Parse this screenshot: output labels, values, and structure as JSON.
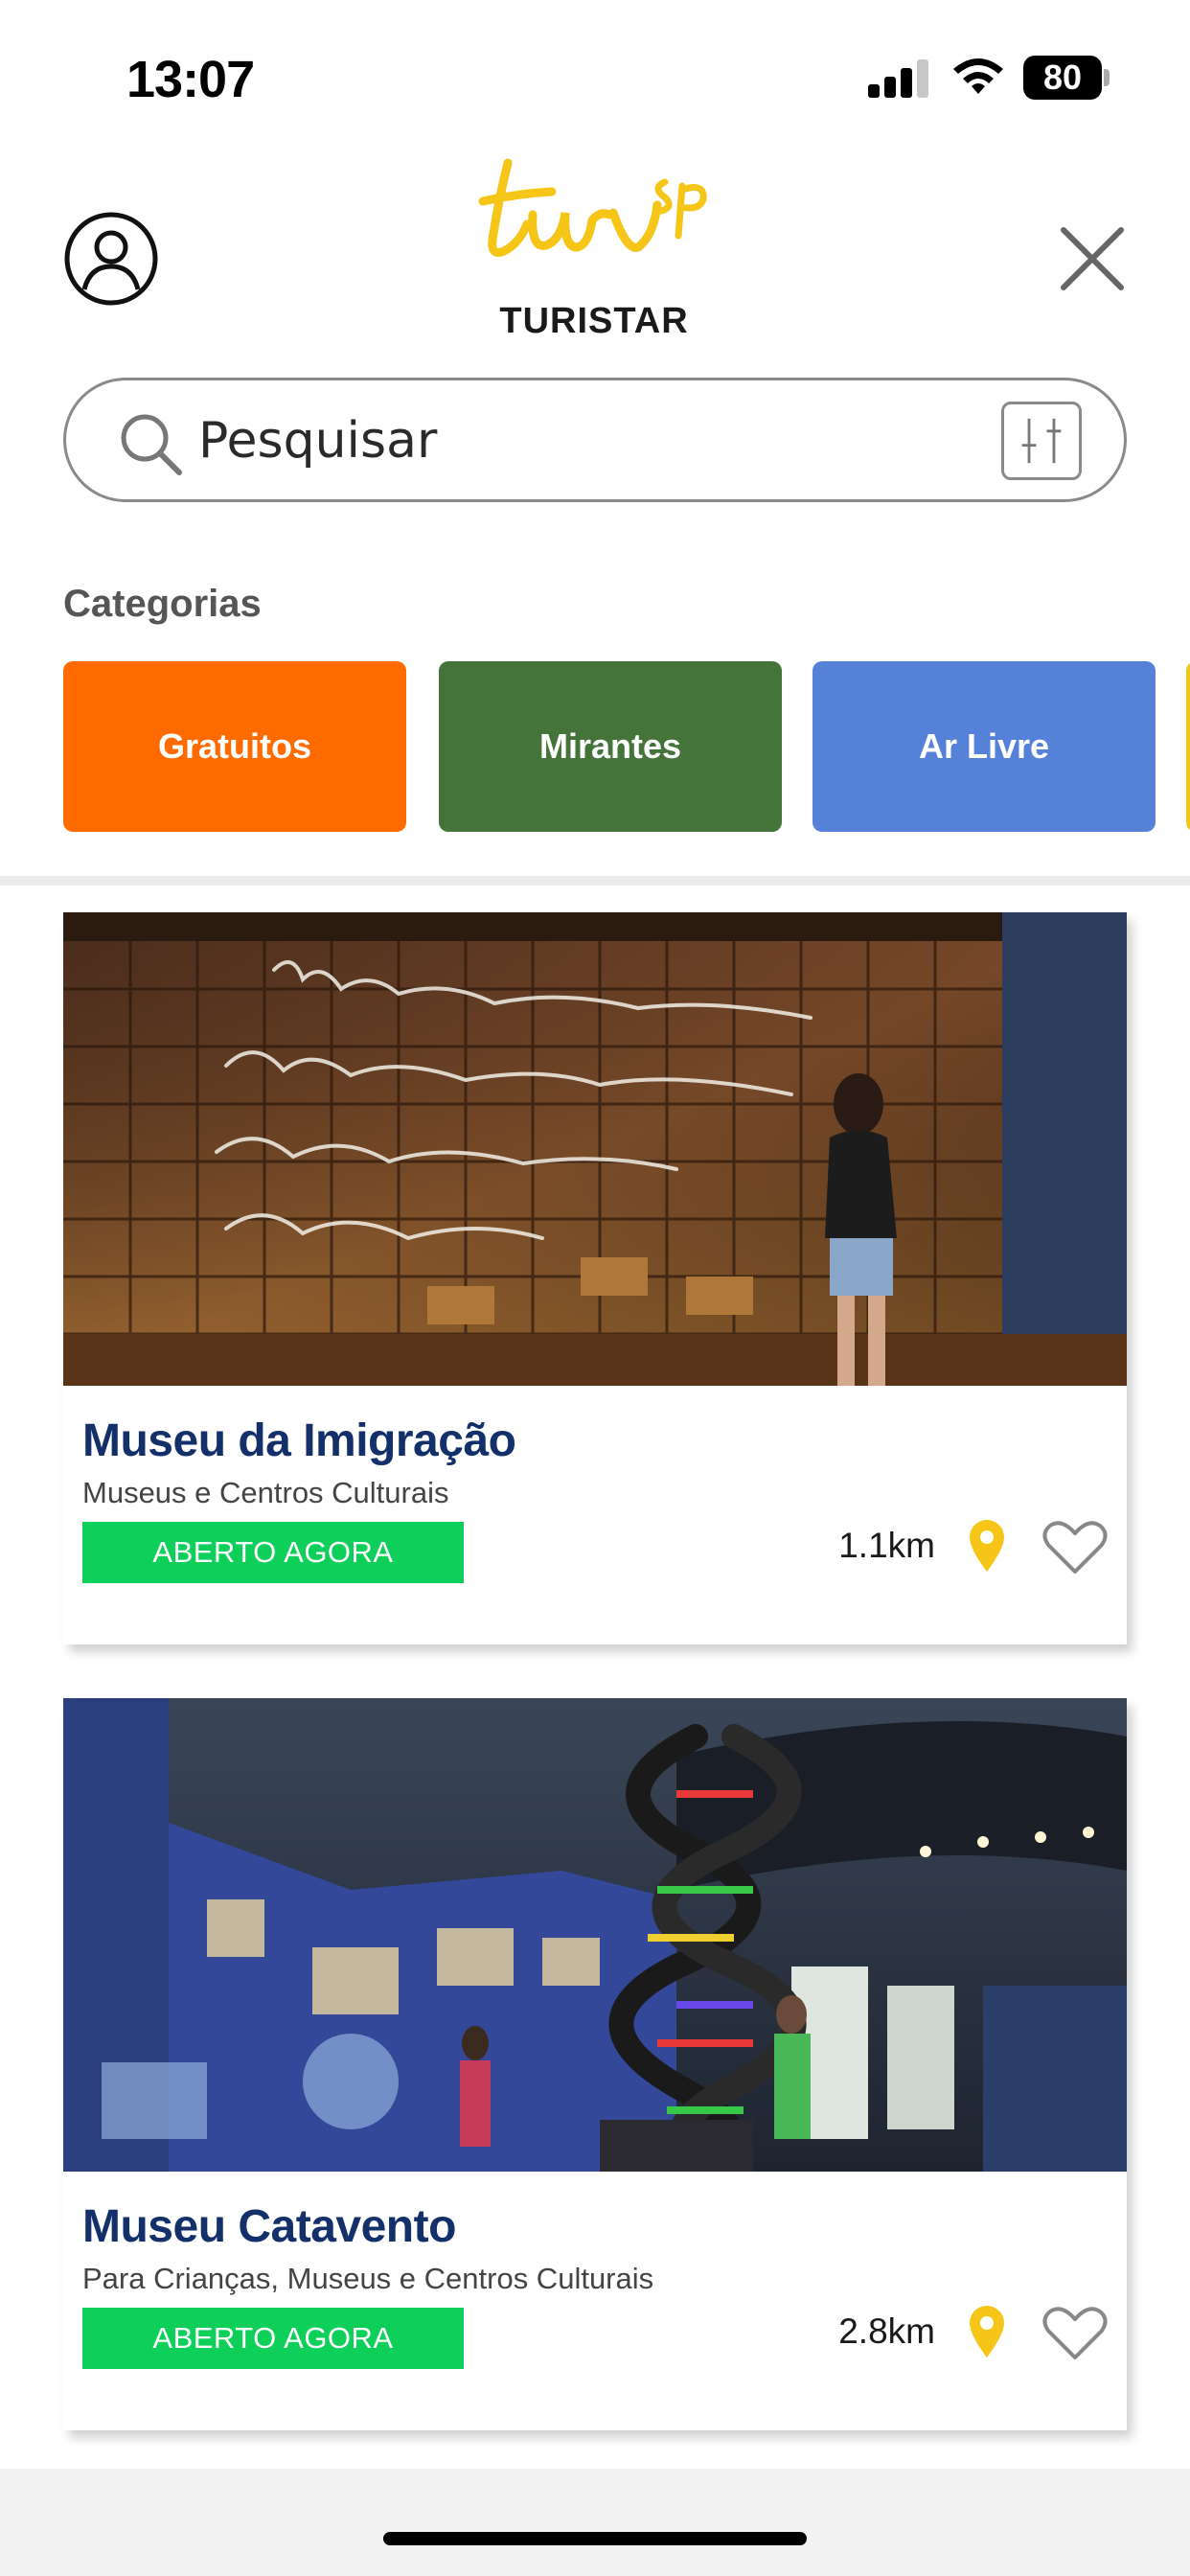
{
  "status_bar": {
    "time": "13:07",
    "battery": "80"
  },
  "header": {
    "brand_name": "TURISTAR",
    "logo_text": "tur sp"
  },
  "search": {
    "placeholder": "Pesquisar"
  },
  "categories": {
    "title": "Categorias",
    "items": [
      {
        "label": "Gratuitos",
        "color": "#ff6b00"
      },
      {
        "label": "Mirantes",
        "color": "#44743a"
      },
      {
        "label": "Ar Livre",
        "color": "#5582d8"
      },
      {
        "label": "",
        "color": "#f5c518"
      }
    ]
  },
  "places": [
    {
      "title": "Museu da Imigração",
      "subtitle": "Museus e Centros Culturais",
      "status": "ABERTO AGORA",
      "distance": "1.1km"
    },
    {
      "title": "Museu Catavento",
      "subtitle": "Para Crianças, Museus e Centros Culturais",
      "status": "ABERTO AGORA",
      "distance": "2.8km"
    }
  ],
  "colors": {
    "accent_yellow": "#f5c518",
    "title_blue": "#13306b",
    "open_green": "#0dcf5a"
  }
}
